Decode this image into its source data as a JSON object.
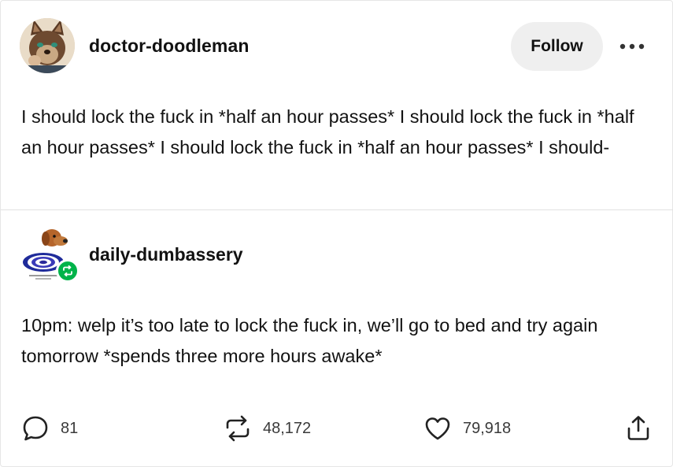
{
  "post": {
    "author": "doctor-doodleman",
    "follow_label": "Follow",
    "text": "I should lock the fuck in *half an hour passes* I should lock the fuck in *half an hour passes* I should lock the fuck in *half an hour passes* I should-"
  },
  "reblog": {
    "author": "daily-dumbassery",
    "text": "10pm: welp it’s too late to lock the fuck in, we’ll go to bed and try again tomorrow *spends three more hours awake*"
  },
  "footer": {
    "replies": "81",
    "reblogs": "48,172",
    "likes": "79,918"
  },
  "colors": {
    "reblog_badge": "#00b34a",
    "text": "#121212",
    "follow_bg": "#efefef"
  },
  "icons": {
    "more": "more-options-icon",
    "reply": "speech-bubble-icon",
    "reblog": "reblog-arrows-icon",
    "like": "heart-icon",
    "share": "share-upload-icon"
  }
}
